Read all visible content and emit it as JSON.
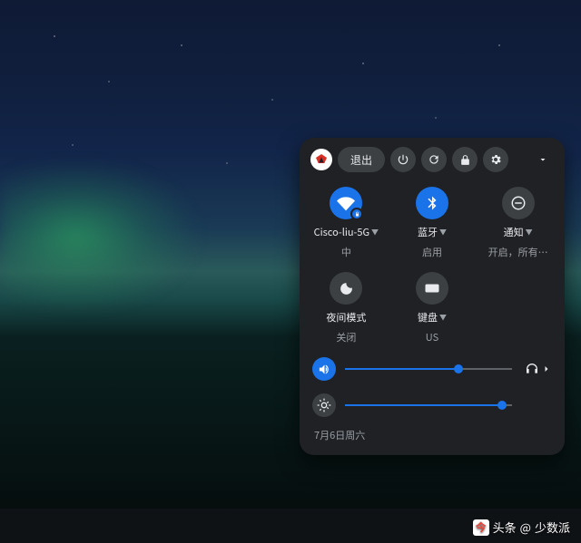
{
  "header": {
    "signout_label": "退出"
  },
  "tiles": {
    "wifi": {
      "label": "Cisco-liu-5G",
      "sub": "中"
    },
    "bluetooth": {
      "label": "蓝牙",
      "sub": "启用"
    },
    "notify": {
      "label": "通知",
      "sub": "开启，所有…"
    },
    "nightlight": {
      "label": "夜间模式",
      "sub": "关闭"
    },
    "keyboard": {
      "label": "键盘",
      "sub": "US"
    }
  },
  "sliders": {
    "volume_pct": 68,
    "brightness_pct": 94
  },
  "footer": {
    "date": "7月6日周六"
  },
  "watermark": {
    "prefix": "头条",
    "at": "@",
    "name": "少数派"
  }
}
